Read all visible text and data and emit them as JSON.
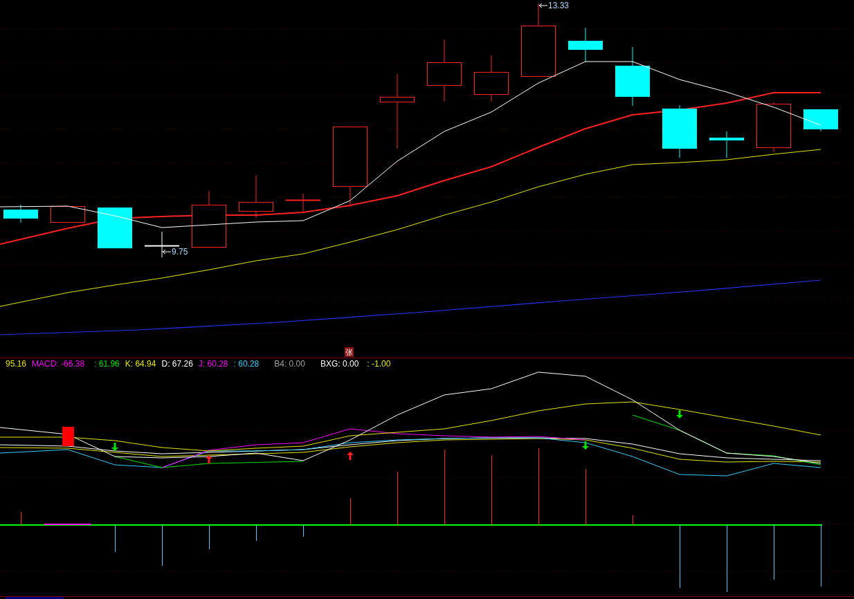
{
  "price_labels": [
    {
      "kind": "high",
      "text": "13.33"
    },
    {
      "kind": "low",
      "text": "9.75"
    }
  ],
  "panel_badge": {
    "text": "张"
  },
  "indicator_values": [
    {
      "text": "95.16",
      "color": "#e6e600"
    },
    {
      "text": "MACD: -66.38",
      "color": "#ff00ff"
    },
    {
      "text": ": 61.96",
      "color": "#00e600"
    },
    {
      "text": "K: 64.94",
      "color": "#e6e600"
    },
    {
      "text": "D: 67.26",
      "color": "#ffffff"
    },
    {
      "text": "J: 60.28",
      "color": "#ff00ff"
    },
    {
      "text": ": 60.28",
      "color": "#33ccff"
    },
    {
      "text": "B4: 0.00",
      "color": "#a0a0a0"
    },
    {
      "text": "BXG: 0.00",
      "color": "#ffffff"
    },
    {
      "text": ": -1.00",
      "color": "#e6e600"
    }
  ]
}
